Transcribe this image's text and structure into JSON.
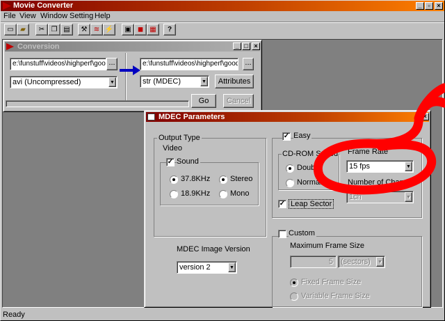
{
  "app": {
    "title": "Movie Converter",
    "status": "Ready"
  },
  "menu": [
    "File",
    "View",
    "Window",
    "Setting",
    "Help"
  ],
  "colors": {
    "title_left": "#800000",
    "title_right": "#ff8000",
    "accent_arrow": "#0000c0",
    "annotation": "#ff0000"
  },
  "toolbar": {
    "icons": [
      "new-icon",
      "open-icon",
      "cut-icon",
      "copy-icon",
      "paste-icon",
      "tools-icon",
      "convert-icon",
      "red-tool-icon",
      "window-icon",
      "stop-icon",
      "batch-icon",
      "help-icon"
    ]
  },
  "conversion": {
    "title": "Conversion",
    "source_path": "e:\\funstuff\\videos\\highperf\\goodb",
    "source_browse": "...",
    "source_format": "avi (Uncompressed)",
    "dest_path": "e:\\funstuff\\videos\\highperf\\goodtim",
    "dest_browse": "...",
    "dest_format": "str (MDEC)",
    "attributes_label": "Attributes",
    "go_label": "Go",
    "cancel_label": "Cancel"
  },
  "mdec": {
    "title": "MDEC Parameters",
    "output_type_label": "Output Type",
    "video_label": "Video",
    "sound_label": "Sound",
    "rate_high": "37.8KHz",
    "rate_low": "18.9KHz",
    "stereo": "Stereo",
    "mono": "Mono",
    "easy_label": "Easy",
    "cdrom_label": "CD-ROM Speed",
    "double_label": "Double",
    "normal_label": "Normal",
    "frame_rate_label": "Frame Rate",
    "frame_rate_value": "15 fps",
    "channels_label": "Number of Channels",
    "channels_value": "1ch",
    "leap_label": "Leap Sector",
    "version_label": "MDEC Image Version",
    "version_value": "version 2",
    "custom_label": "Custom",
    "max_frame_label": "Maximum Frame Size",
    "max_frame_value": "5",
    "max_frame_unit": "(sectors)",
    "fixed_label": "Fixed Frame Size",
    "variable_label": "Variable Frame Size"
  }
}
